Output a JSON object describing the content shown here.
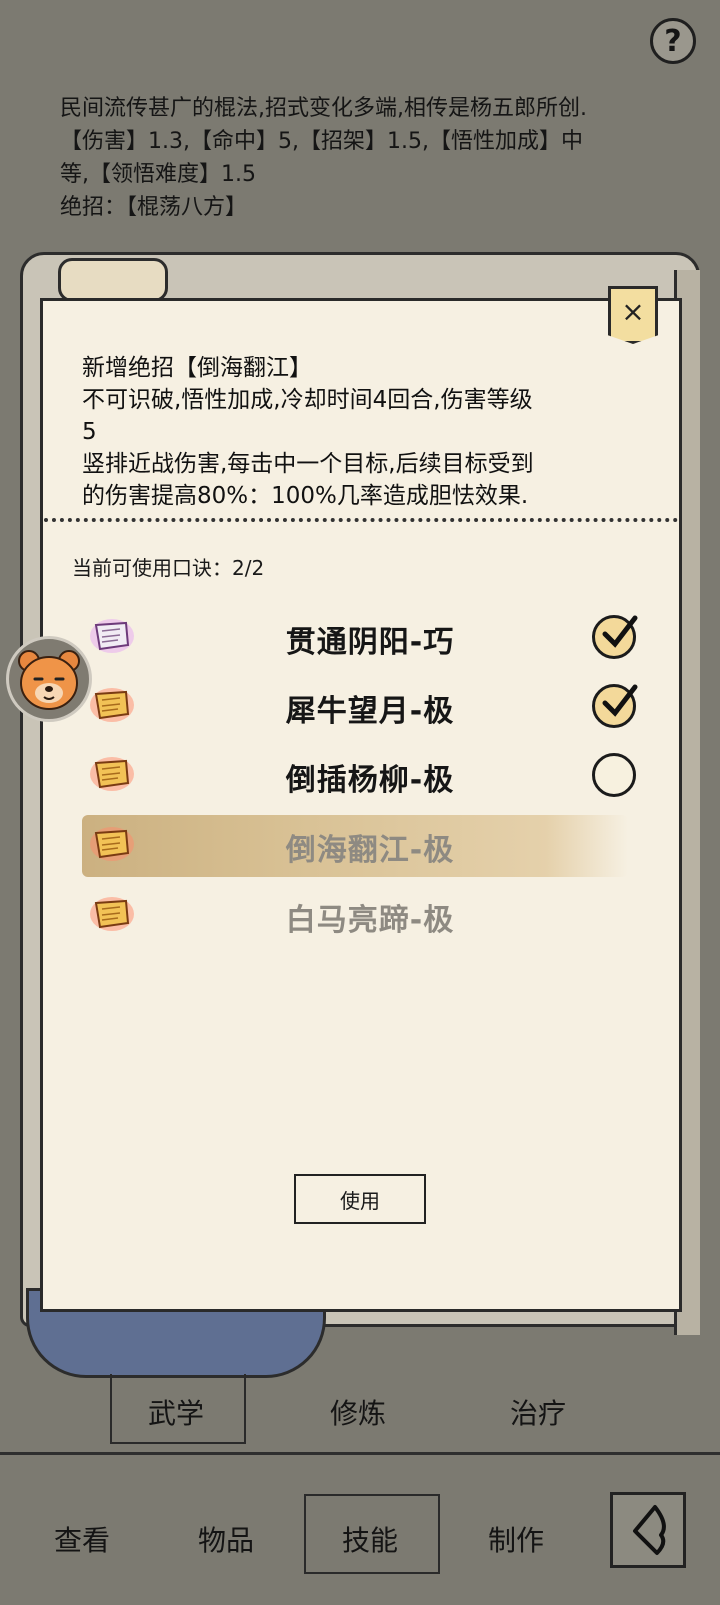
{
  "header": {
    "help_label": "?",
    "desc_lines": [
      "民间流传甚广的棍法,招式变化多端,相传是杨五郎所创.",
      "【伤害】1.3,【命中】5,【招架】1.5,【悟性加成】中",
      "等,【领悟难度】1.5",
      "绝招：【棍荡八方】"
    ]
  },
  "panel": {
    "close_label": "×",
    "info_lines": [
      "新增绝招【倒海翻江】",
      "不可识破,悟性加成,冷却时间4回合,伤害等级",
      "5",
      "竖排近战伤害,每击中一个目标,后续目标受到",
      "的伤害提高80%：100%几率造成胆怯效果."
    ],
    "usage_text": "当前可使用口诀：2/2",
    "items": [
      {
        "label": "贯通阴阳-巧",
        "checked": true,
        "icon": "purple-scroll-icon"
      },
      {
        "label": "犀牛望月-极",
        "checked": true,
        "icon": "gold-scroll-icon"
      },
      {
        "label": "倒插杨柳-极",
        "checked": false,
        "icon": "gold-scroll-icon"
      },
      {
        "label": "倒海翻江-极",
        "disabled": true,
        "icon": "gold-scroll-icon"
      },
      {
        "label": "白马亮蹄-极",
        "disabled": true,
        "icon": "gold-scroll-icon"
      }
    ],
    "use_button": "使用"
  },
  "subtabs": [
    "武学",
    "修炼",
    "治疗"
  ],
  "bottom_nav": [
    "查看",
    "物品",
    "技能",
    "制作"
  ],
  "colors": {
    "panel_bg": "#f6f0e2",
    "page_bg": "#7c7a71",
    "highlight": "#d7bf91"
  }
}
